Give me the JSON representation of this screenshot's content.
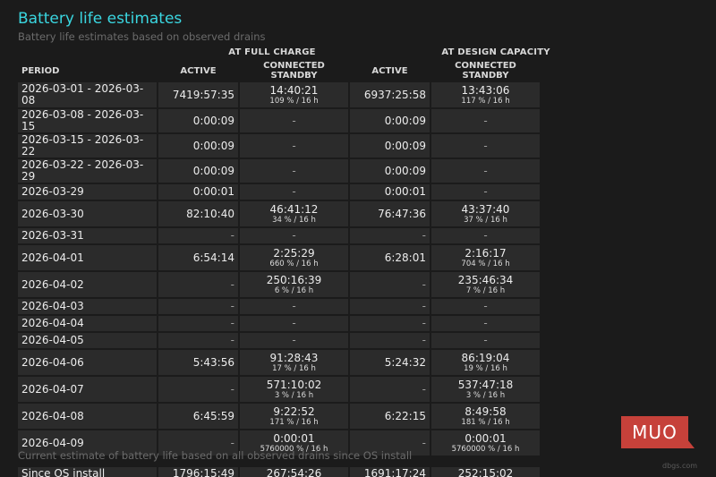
{
  "header": {
    "title": "Battery life estimates",
    "subtitle": "Battery life estimates based on observed drains"
  },
  "groups": {
    "full_charge": "AT FULL CHARGE",
    "design_capacity": "AT DESIGN CAPACITY"
  },
  "columns": {
    "period": "PERIOD",
    "active_full": "ACTIVE",
    "standby_full": "CONNECTED STANDBY",
    "active_design": "ACTIVE",
    "standby_design": "CONNECTED STANDBY"
  },
  "rows": [
    {
      "period": "2026-03-01 - 2026-03-08",
      "active_full": "7419:57:35",
      "standby_full": "14:40:21",
      "standby_full_sub": "109 % / 16 h",
      "active_design": "6937:25:58",
      "standby_design": "13:43:06",
      "standby_design_sub": "117 % / 16 h"
    },
    {
      "period": "2026-03-08 - 2026-03-15",
      "active_full": "0:00:09",
      "standby_full": "-",
      "standby_full_sub": "",
      "active_design": "0:00:09",
      "standby_design": "-",
      "standby_design_sub": ""
    },
    {
      "period": "2026-03-15 - 2026-03-22",
      "active_full": "0:00:09",
      "standby_full": "-",
      "standby_full_sub": "",
      "active_design": "0:00:09",
      "standby_design": "-",
      "standby_design_sub": ""
    },
    {
      "period": "2026-03-22 - 2026-03-29",
      "active_full": "0:00:09",
      "standby_full": "-",
      "standby_full_sub": "",
      "active_design": "0:00:09",
      "standby_design": "-",
      "standby_design_sub": ""
    },
    {
      "period": "2026-03-29",
      "active_full": "0:00:01",
      "standby_full": "-",
      "standby_full_sub": "",
      "active_design": "0:00:01",
      "standby_design": "-",
      "standby_design_sub": ""
    },
    {
      "period": "2026-03-30",
      "active_full": "82:10:40",
      "standby_full": "46:41:12",
      "standby_full_sub": "34 % / 16 h",
      "active_design": "76:47:36",
      "standby_design": "43:37:40",
      "standby_design_sub": "37 % / 16 h"
    },
    {
      "period": "2026-03-31",
      "active_full": "-",
      "standby_full": "-",
      "standby_full_sub": "",
      "active_design": "-",
      "standby_design": "-",
      "standby_design_sub": ""
    },
    {
      "period": "2026-04-01",
      "active_full": "6:54:14",
      "standby_full": "2:25:29",
      "standby_full_sub": "660 % / 16 h",
      "active_design": "6:28:01",
      "standby_design": "2:16:17",
      "standby_design_sub": "704 % / 16 h"
    },
    {
      "period": "2026-04-02",
      "active_full": "-",
      "standby_full": "250:16:39",
      "standby_full_sub": "6 % / 16 h",
      "active_design": "-",
      "standby_design": "235:46:34",
      "standby_design_sub": "7 % / 16 h"
    },
    {
      "period": "2026-04-03",
      "active_full": "-",
      "standby_full": "-",
      "standby_full_sub": "",
      "active_design": "-",
      "standby_design": "-",
      "standby_design_sub": ""
    },
    {
      "period": "2026-04-04",
      "active_full": "-",
      "standby_full": "-",
      "standby_full_sub": "",
      "active_design": "-",
      "standby_design": "-",
      "standby_design_sub": ""
    },
    {
      "period": "2026-04-05",
      "active_full": "-",
      "standby_full": "-",
      "standby_full_sub": "",
      "active_design": "-",
      "standby_design": "-",
      "standby_design_sub": ""
    },
    {
      "period": "2026-04-06",
      "active_full": "5:43:56",
      "standby_full": "91:28:43",
      "standby_full_sub": "17 % / 16 h",
      "active_design": "5:24:32",
      "standby_design": "86:19:04",
      "standby_design_sub": "19 % / 16 h"
    },
    {
      "period": "2026-04-07",
      "active_full": "-",
      "standby_full": "571:10:02",
      "standby_full_sub": "3 % / 16 h",
      "active_design": "-",
      "standby_design": "537:47:18",
      "standby_design_sub": "3 % / 16 h"
    },
    {
      "period": "2026-04-08",
      "active_full": "6:45:59",
      "standby_full": "9:22:52",
      "standby_full_sub": "171 % / 16 h",
      "active_design": "6:22:15",
      "standby_design": "8:49:58",
      "standby_design_sub": "181 % / 16 h"
    },
    {
      "period": "2026-04-09",
      "active_full": "-",
      "standby_full": "0:00:01",
      "standby_full_sub": "5760000 % / 16 h",
      "active_design": "-",
      "standby_design": "0:00:01",
      "standby_design_sub": "5760000 % / 16 h"
    }
  ],
  "footer": {
    "text": "Current estimate of battery life based on all observed drains since OS install",
    "since": {
      "period": "Since OS install",
      "active_full": "1796:15:49",
      "standby_full": "267:54:26",
      "active_design": "1691:17:24",
      "standby_design": "252:15:02"
    }
  },
  "logo": {
    "text": "MUO"
  },
  "watermark": "dbgs.com"
}
